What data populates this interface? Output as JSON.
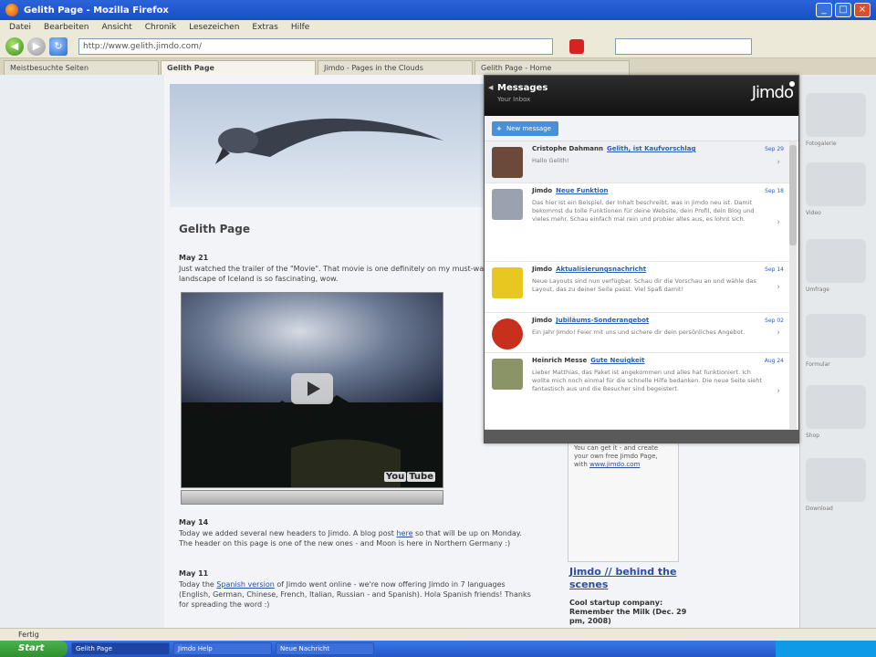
{
  "window": {
    "title": "Gelith Page - Mozilla Firefox",
    "buttons": {
      "minimize": "_",
      "maximize": "□",
      "close": "×"
    }
  },
  "menu": [
    "Datei",
    "Bearbeiten",
    "Ansicht",
    "Chronik",
    "Lesezeichen",
    "Extras",
    "Hilfe"
  ],
  "nav": {
    "back": "◀",
    "forward": "▶",
    "reload": "↻",
    "url": "http://www.gelith.jimdo.com/"
  },
  "tabs": [
    "Meistbesuchte Seiten",
    "Gelith Page",
    "Jimdo - Pages in the Clouds",
    "Gelith Page - Home"
  ],
  "page": {
    "heading": "Gelith Page",
    "post1": {
      "date": "May 21",
      "text": "Just watched the trailer of the \"Movie\". That movie is one definitely on my must-watch list. The landscape of Iceland is so fascinating, wow."
    },
    "video_logo": {
      "you": "You",
      "tube": "Tube"
    },
    "post2": {
      "date": "May 14",
      "text_before": "Today we added several new headers to Jimdo. A blog post ",
      "link": "here",
      "text_after": " so that will be up on Monday. The header on this page is one of the new ones - and Moon is here in Northern Germany :)"
    },
    "post3": {
      "date": "May 11",
      "text_before": "Today the ",
      "link": "Spanish version",
      "text_after": " of Jimdo went online - we're now offering Jimdo in 7 languages (English, German, Chinese, French, Italian, Russian - and Spanish). Hola Spanish friends! Thanks for spreading the word :)"
    },
    "sidebox_text": "You can get it - and create your own free Jimdo Page, with ",
    "sidebox_link": "www.jimdo.com",
    "jimdo_heading": "Jimdo // behind the scenes",
    "jimdo_sub": "Cool startup company: Remember the Milk (Dec. 29 pm, 2008)"
  },
  "messages": {
    "title": "Messages",
    "subtitle": "Your Inbox",
    "brand": "Jimdo",
    "new_button": "New message",
    "items": [
      {
        "from": "Cristophe Dahmann",
        "subject": "Gelith, ist Kaufvorschlag",
        "date": "Sep 29",
        "body": "Hallo Gelith!",
        "avatar_color": "#6b4a3a"
      },
      {
        "from": "Jimdo",
        "subject": "Neue Funktion",
        "date": "Sep 18",
        "body": "Das hier ist ein Beispiel, der Inhalt beschreibt, was in Jimdo neu ist. Damit bekommst du tolle Funktionen für deine Website, dein Profil, dein Blog und vieles mehr. Schau einfach mal rein und probier alles aus, es lohnt sich.",
        "avatar_color": "#9aa2b0"
      },
      {
        "from": "Jimdo",
        "subject": "Aktualisierungsnachricht",
        "date": "Sep 14",
        "body": "Neue Layouts sind nun verfügbar. Schau dir die Vorschau an und wähle das Layout, das zu deiner Seite passt. Viel Spaß damit!",
        "avatar_color": "#e8c820"
      },
      {
        "from": "Jimdo",
        "subject": "Jubiläums-Sonderangebot",
        "date": "Sep 02",
        "body": "Ein Jahr Jimdo! Feier mit uns und sichere dir dein persönliches Angebot.",
        "avatar_color": "#c8301e"
      },
      {
        "from": "Heinrich Messe",
        "subject": "Gute Neuigkeit",
        "date": "Aug 24",
        "body": "Lieber Matthias, das Paket ist angekommen und alles hat funktioniert. Ich wollte mich noch einmal für die schnelle Hilfe bedanken. Die neue Seite sieht fantastisch aus und die Besucher sind begeistert.",
        "avatar_color": "#8a9466"
      }
    ]
  },
  "sidebar_labels": [
    "Fotogalerie",
    "Video",
    "Umfrage",
    "Formular",
    "Shop",
    "Download"
  ],
  "status": "Fertig",
  "taskbar": {
    "start": "Start",
    "items": [
      "Gelith Page",
      "Jimdo Help",
      "Neue Nachricht"
    ]
  }
}
